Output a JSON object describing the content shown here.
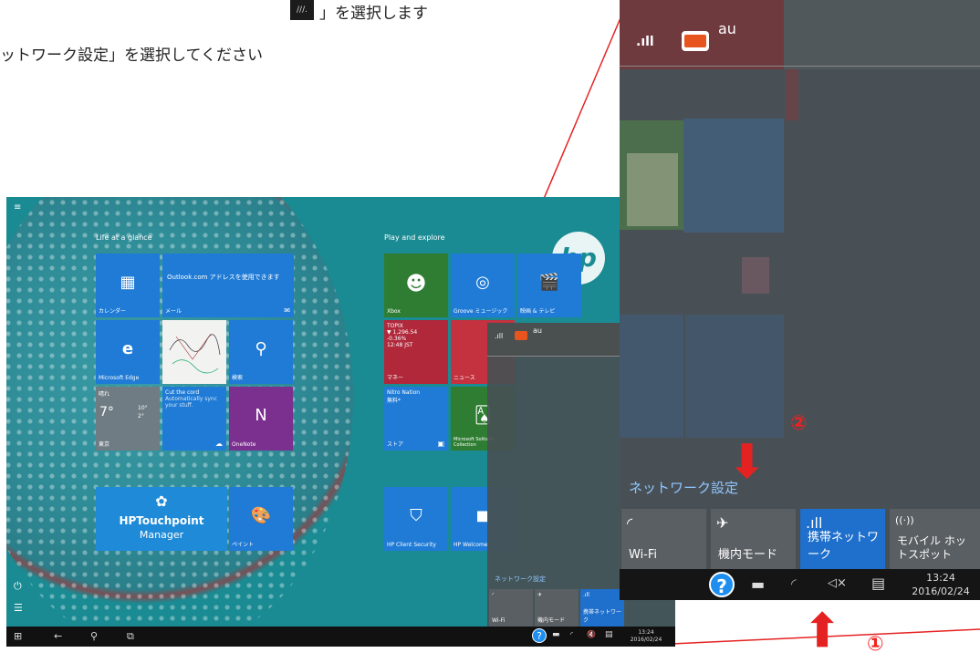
{
  "instructions": {
    "line1_tail": "」を選択します",
    "line2": "ットワーク設定」を選択してください"
  },
  "inline_icon_label": "///.",
  "start": {
    "group1": "Life at a glance",
    "group2": "Play and explore",
    "tiles": {
      "calendar": "カレンダー",
      "mail_title": "Outlook.com アドレスを使用できます",
      "mail": "メール",
      "edge": "Microsoft Edge",
      "search": "検索",
      "weather_l1": "晴れ",
      "weather_temp": "7°",
      "weather_hi": "10°",
      "weather_lo": "2°",
      "weather_city": "東京",
      "cortana_l1": "Cut the cord",
      "cortana_l2": "Automatically sync your stuff.",
      "onenote": "OneNote",
      "xbox": "Xbox",
      "groove": "Groove ミュージック",
      "movies": "映画 & テレビ",
      "money_title": "TOPIX",
      "money_l1": "▼ 1,296.54",
      "money_l2": "-0.36%",
      "money_l3": "12:48 JST",
      "money": "マネー",
      "news": "ニュース",
      "nitro_l1": "Nitro Nation",
      "nitro_l2": "無料*",
      "store": "ストア",
      "solitaire": "Microsoft Solitaire Collection",
      "hp_touchpoint_l1": "HPTouchpoint",
      "hp_touchpoint_l2": "Manager",
      "paint": "ペイント",
      "hp_client": "HP Client Security",
      "hp_welcome": "HP Welcome"
    },
    "mini_panel": {
      "carrier": "au",
      "network_settings": "ネットワーク設定",
      "quick": [
        "Wi-Fi",
        "機内モード",
        "携帯ネットワーク"
      ]
    },
    "clock_time": "13:24",
    "clock_date": "2016/02/24"
  },
  "zoom": {
    "carrier": "au",
    "network_settings": "ネットワーク設定",
    "quick": [
      {
        "label": "Wi-Fi",
        "glyph": "◜",
        "color": "#5a5f63"
      },
      {
        "label": "機内モード",
        "glyph": "✈",
        "color": "#5a5f63"
      },
      {
        "label": "携帯ネットワーク",
        "glyph": ".ıll",
        "color": "#1f6fcc"
      },
      {
        "label": "モバイル ホットスポット",
        "glyph": "((·))",
        "color": "#5a5f63"
      }
    ],
    "clock_time": "13:24",
    "clock_date": "2016/02/24"
  },
  "steps": {
    "one": "①",
    "two": "②"
  },
  "colors": {
    "accent_blue": "#1f6fcc",
    "annotation_red": "#e52222"
  }
}
